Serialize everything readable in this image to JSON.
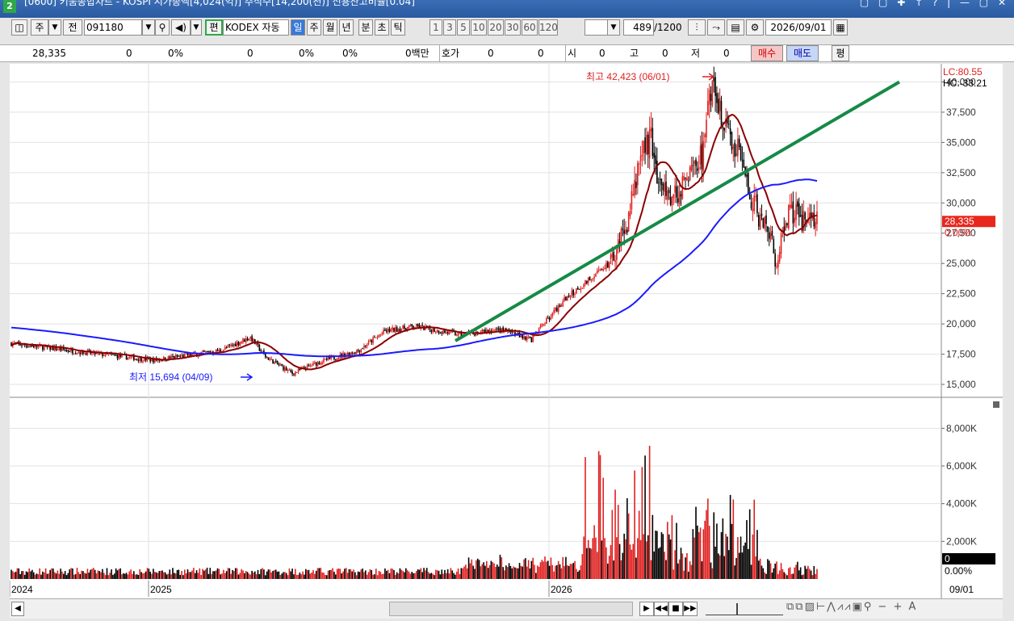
{
  "titlebar": {
    "window_number": "2",
    "title": "[0600] 키움종합차트 - KOSPI 시가총액[4,024(억)] 주식수[14,200(천)] 신용잔고비율[0.04]"
  },
  "toolbar": {
    "period_type": "주",
    "prev_label": "전",
    "code": "091180",
    "edit_label": "편",
    "stock_name": "KODEX 자동",
    "tabs": [
      "일",
      "주",
      "월",
      "년",
      "분",
      "초",
      "틱"
    ],
    "active_tab": "일",
    "intervals": [
      "1",
      "3",
      "5",
      "10",
      "20",
      "30",
      "60",
      "120"
    ],
    "count": "489",
    "count_total": "/1200",
    "date": "2026/09/01"
  },
  "quote": {
    "price": "28,335",
    "change": "0",
    "change_pct": "0%",
    "volume": "0",
    "vol_pct1": "0%",
    "vol_pct2": "0%",
    "amount": "0백만",
    "hoga_label": "호가",
    "hoga1": "0",
    "hoga2": "0",
    "open_label": "시",
    "open": "0",
    "high_label": "고",
    "high": "0",
    "low_label": "저",
    "low": "0",
    "buy_label": "매수",
    "sell_label": "매도",
    "flat_label": "평"
  },
  "chart_data": {
    "type": "candlestick",
    "price_ticks": [
      "40,000",
      "37,500",
      "35,000",
      "32,500",
      "30,000",
      "27,500",
      "25,000",
      "22,500",
      "20,000",
      "17,500",
      "15,000"
    ],
    "volume_ticks": [
      "8,000K",
      "6,000K",
      "4,000K",
      "2,000K"
    ],
    "x_labels": [
      "2024",
      "2025",
      "2026"
    ],
    "x_last_label": "09/01",
    "lc_label": "LC:80.55",
    "hc_label": "HC:-33.21",
    "current_price": "28,335",
    "current_pct": "0.00%",
    "volume_current": "0",
    "volume_pct": "0.00%",
    "high_annotation": "최고 42,423 (06/01)",
    "low_annotation": "최저 15,694 (04/09)",
    "ylim": [
      14000,
      41500
    ],
    "volume_max": 9000
  },
  "colors": {
    "up": "#e02020",
    "down": "#000000",
    "ma_short": "#8b0000",
    "ma_long": "#1a1aff",
    "trend": "#168a46",
    "price_box": "#e8281e"
  }
}
